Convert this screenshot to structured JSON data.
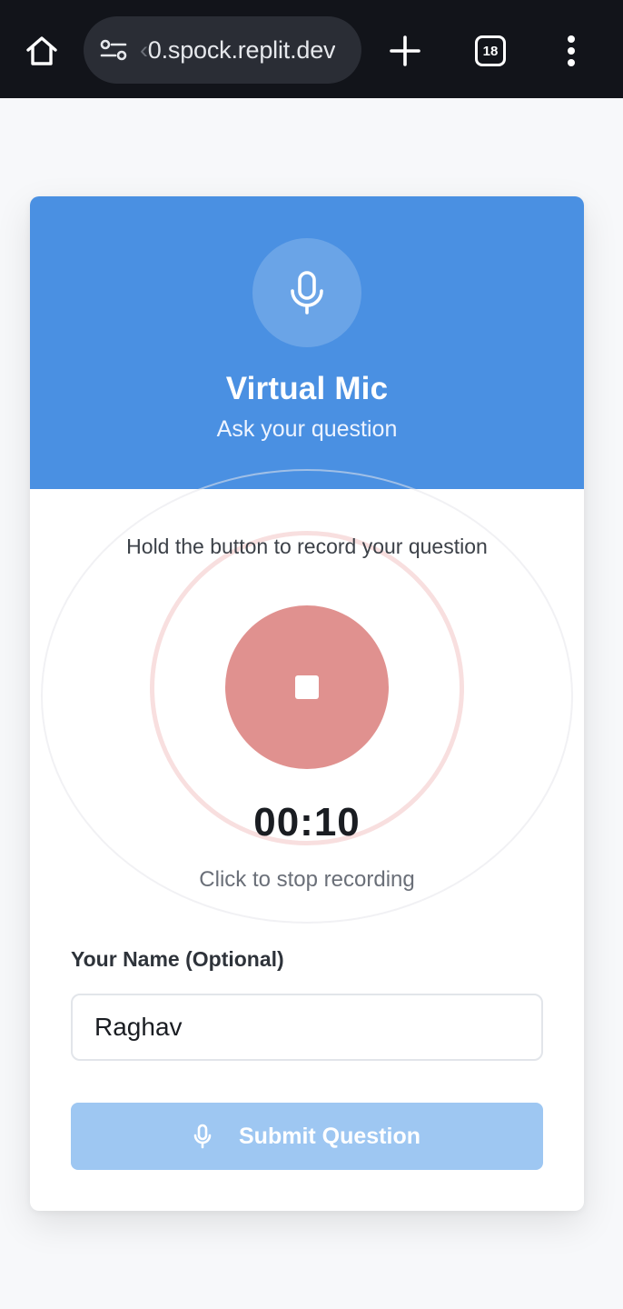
{
  "browser": {
    "url_prefix": "‹",
    "url": "0.spock.replit.dev",
    "tab_count": "18"
  },
  "header": {
    "title": "Virtual Mic",
    "subtitle": "Ask your question",
    "icon": "microphone-icon"
  },
  "recorder": {
    "instruction": "Hold the button to record your question",
    "timer": "00:10",
    "stop_hint": "Click to stop recording",
    "button_icon": "stop-icon"
  },
  "form": {
    "name_label": "Your Name (Optional)",
    "name_value": "Raghav",
    "submit_label": "Submit Question"
  },
  "colors": {
    "header_blue": "#4a90e2",
    "record_red": "#e0918f",
    "submit_disabled": "#9ec7f2"
  }
}
